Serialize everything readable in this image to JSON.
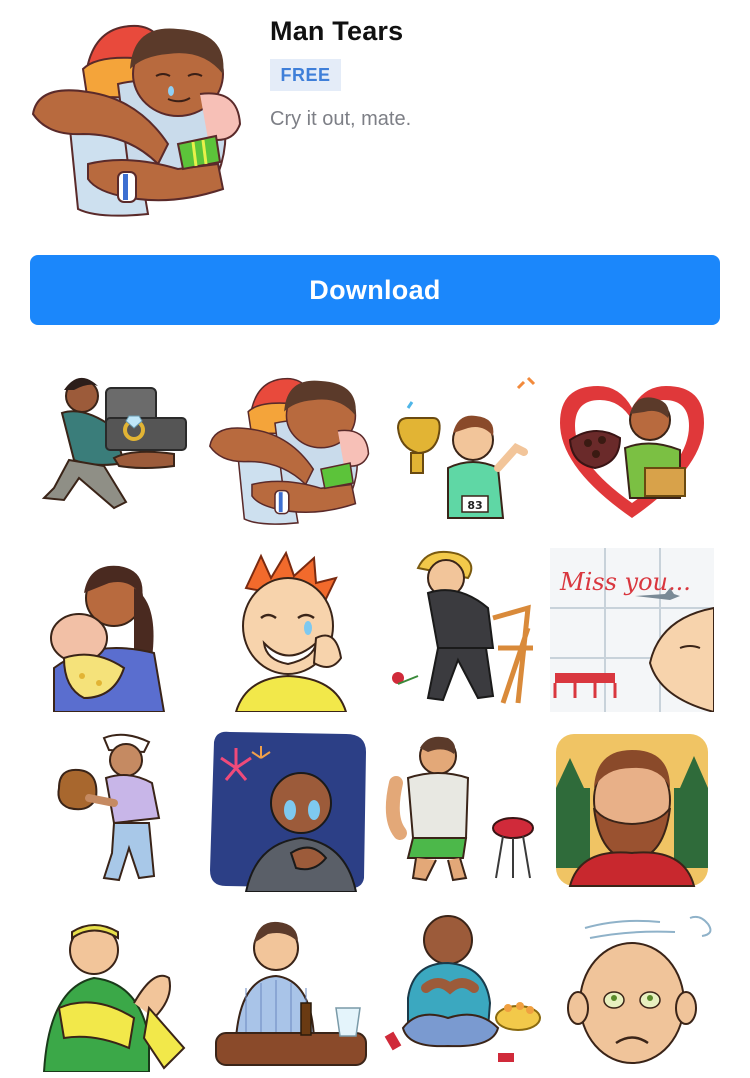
{
  "pack": {
    "title": "Man Tears",
    "price_badge": "FREE",
    "subtitle": "Cry it out, mate."
  },
  "actions": {
    "download_label": "Download"
  },
  "stickers": [
    {
      "name": "sticker-proposal-ring",
      "caption": ""
    },
    {
      "name": "sticker-bro-hug",
      "caption": ""
    },
    {
      "name": "sticker-trophy-winner",
      "caption": "83"
    },
    {
      "name": "sticker-heart-chocolates",
      "caption": ""
    },
    {
      "name": "sticker-mom-baby",
      "caption": ""
    },
    {
      "name": "sticker-redhead-tears",
      "caption": ""
    },
    {
      "name": "sticker-sad-suit-chair",
      "caption": ""
    },
    {
      "name": "sticker-miss-you",
      "caption": "Miss you..."
    },
    {
      "name": "sticker-baseball-glove",
      "caption": ""
    },
    {
      "name": "sticker-fireworks-salute",
      "caption": ""
    },
    {
      "name": "sticker-bbq-grill",
      "caption": ""
    },
    {
      "name": "sticker-bearded-forest",
      "caption": ""
    },
    {
      "name": "sticker-green-hoodie",
      "caption": ""
    },
    {
      "name": "sticker-bar-drinks",
      "caption": ""
    },
    {
      "name": "sticker-snack-crying",
      "caption": ""
    },
    {
      "name": "sticker-sad-bald",
      "caption": ""
    }
  ],
  "colors": {
    "accent": "#1b87fb",
    "badge_bg": "#e4ecf8",
    "badge_text": "#3f7fd9"
  }
}
